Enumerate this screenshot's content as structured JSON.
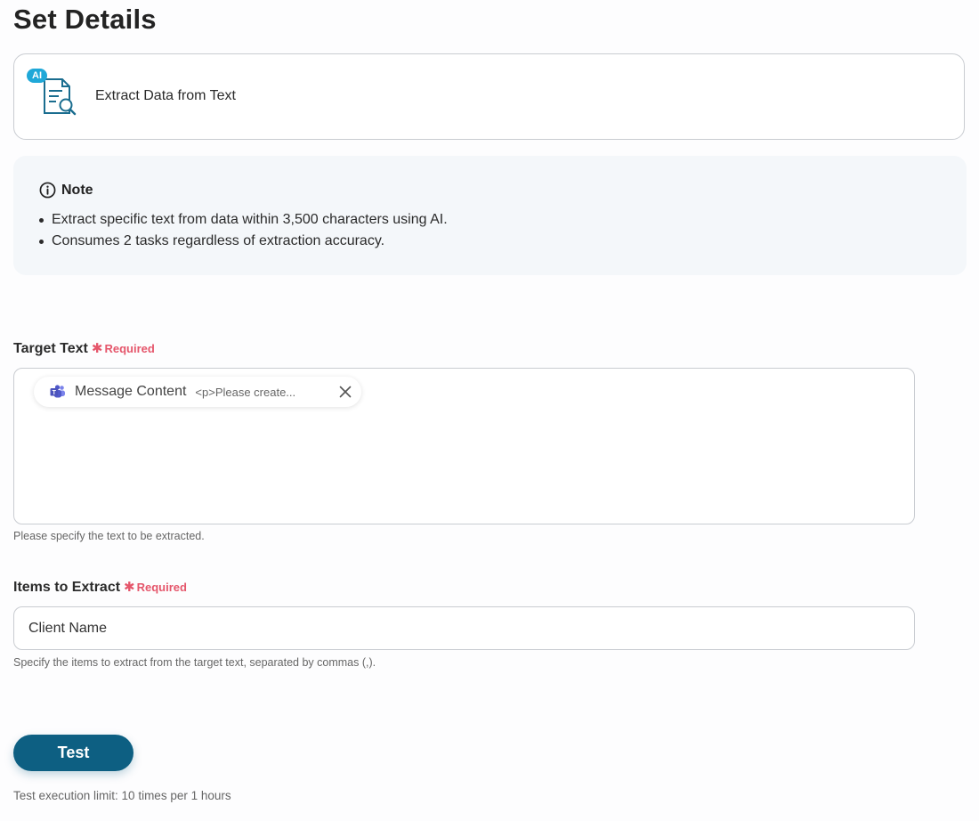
{
  "page_title": "Set Details",
  "action_card": {
    "badge": "AI",
    "label": "Extract Data from Text",
    "icon": "document-search-icon"
  },
  "note": {
    "title": "Note",
    "icon": "info-icon",
    "items": [
      "Extract specific text from data within 3,500 characters using AI.",
      "Consumes 2 tasks regardless of extraction accuracy."
    ]
  },
  "target_text": {
    "label": "Target Text",
    "required": "Required",
    "chip": {
      "icon": "teams-icon",
      "name": "Message Content",
      "value": "<p>Please create..."
    },
    "helper": "Please specify the text to be extracted."
  },
  "items_to_extract": {
    "label": "Items to Extract",
    "required": "Required",
    "value": "Client Name",
    "helper": "Specify the items to extract from the target text, separated by commas (,)."
  },
  "test": {
    "button_label": "Test",
    "limit_text": "Test execution limit: 10 times per 1 hours"
  },
  "colors": {
    "primary": "#0d5f82",
    "required": "#e5566b",
    "ai_badge": "#1fa8d8",
    "note_bg": "#f4f7fa"
  }
}
